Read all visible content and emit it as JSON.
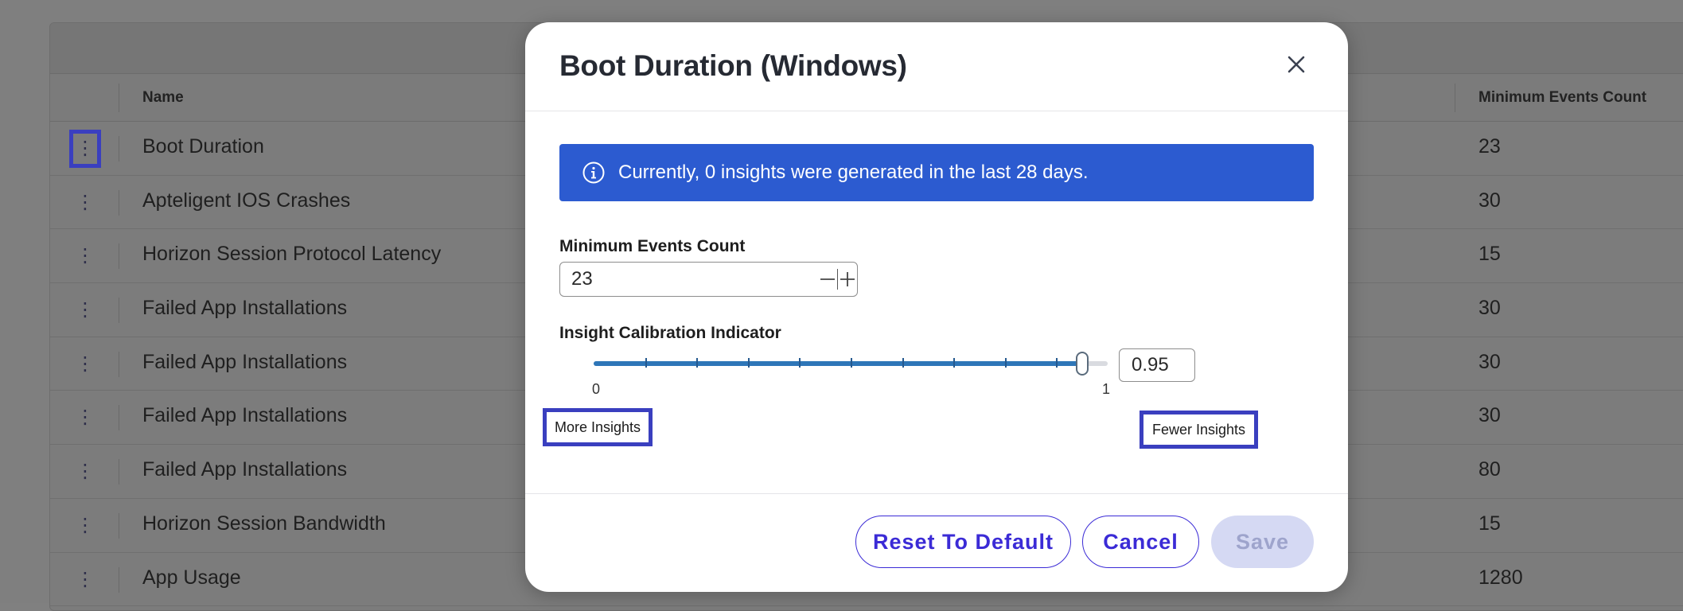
{
  "table": {
    "columns": {
      "name": "Name",
      "min_events": "Minimum Events Count"
    },
    "rows": [
      {
        "name": "Boot Duration",
        "count": "23"
      },
      {
        "name": "Apteligent IOS Crashes",
        "count": "30"
      },
      {
        "name": "Horizon Session Protocol Latency",
        "count": "15"
      },
      {
        "name": "Failed App Installations",
        "count": "30"
      },
      {
        "name": "Failed App Installations",
        "count": "30"
      },
      {
        "name": "Failed App Installations",
        "count": "30"
      },
      {
        "name": "Failed App Installations",
        "count": "80"
      },
      {
        "name": "Horizon Session Bandwidth",
        "count": "15"
      },
      {
        "name": "App Usage",
        "count": "1280"
      }
    ]
  },
  "modal": {
    "title": "Boot Duration (Windows)",
    "banner": "Currently, 0 insights were generated in the last 28 days.",
    "min_events": {
      "label": "Minimum Events Count",
      "value": "23"
    },
    "calibration": {
      "label": "Insight Calibration Indicator",
      "min_label": "0",
      "max_label": "1",
      "value": "0.95",
      "value_fraction": 0.95,
      "more_label": "More Insights",
      "fewer_label": "Fewer Insights"
    },
    "buttons": {
      "reset": "Reset To Default",
      "cancel": "Cancel",
      "save": "Save"
    }
  },
  "colors": {
    "banner": "#2c5bd0",
    "accent": "#3b2bd6",
    "slider": "#2e76b8",
    "highlight": "#3a3fbf",
    "save_disabled_bg": "#d5d9f3"
  },
  "icons": {
    "kebab": "kebab-menu-icon",
    "close": "close-icon",
    "info": "info-icon",
    "minus": "minus-icon",
    "plus": "plus-icon"
  }
}
